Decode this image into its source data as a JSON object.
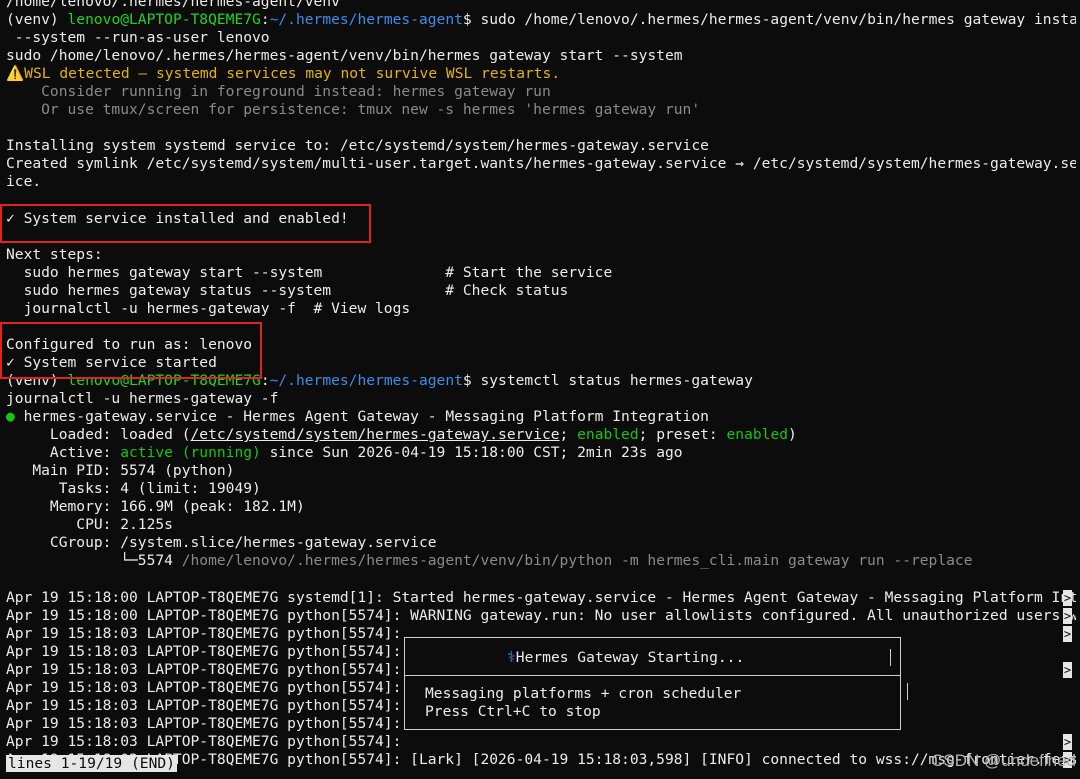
{
  "terminal": {
    "lines": {
      "l0": "/home/lenovo/.hermes/hermes-agent/venv",
      "l1_venv": "(venv) ",
      "l1_user": "lenovo@LAPTOP-T8QEME7G",
      "l1_colon": ":",
      "l1_path": "~/.hermes/hermes-agent",
      "l1_cmd": "$ sudo /home/lenovo/.hermes/hermes-agent/venv/bin/hermes gateway install",
      "l2": " --system --run-as-user lenovo",
      "l3": "sudo /home/lenovo/.hermes/hermes-agent/venv/bin/hermes gateway start --system",
      "l4_icon": "⚠️",
      "l4": "WSL detected — systemd services may not survive WSL restarts.",
      "l5": "    Consider running in foreground instead: hermes gateway run",
      "l6": "    Or use tmux/screen for persistence: tmux new -s hermes 'hermes gateway run'",
      "l8": "Installing system systemd service to: /etc/systemd/system/hermes-gateway.service",
      "l9": "Created symlink /etc/systemd/system/multi-user.target.wants/hermes-gateway.service → /etc/systemd/system/hermes-gateway.serv",
      "l10": "ice.",
      "l12": "✓ System service installed and enabled!",
      "l14": "Next steps:",
      "l15": "  sudo hermes gateway start --system              # Start the service",
      "l16": "  sudo hermes gateway status --system             # Check status",
      "l17": "  journalctl -u hermes-gateway -f  # View logs",
      "l19": "Configured to run as: lenovo",
      "l20": "✓ System service started",
      "l21_venv": "(venv) ",
      "l21_user": "lenovo@LAPTOP-T8QEME7G",
      "l21_colon": ":",
      "l21_path": "~/.hermes/hermes-agent",
      "l21_cmd": "$ systemctl status hermes-gateway",
      "l22": "journalctl -u hermes-gateway -f",
      "l23_dot": "●",
      "l23": " hermes-gateway.service - Hermes Agent Gateway - Messaging Platform Integration",
      "l24_a": "     Loaded: loaded (",
      "l24_link": "/etc/systemd/system/hermes-gateway.service",
      "l24_b": "; ",
      "l24_en1": "enabled",
      "l24_c": "; preset: ",
      "l24_en2": "enabled",
      "l24_d": ")",
      "l25_a": "     Active: ",
      "l25_active": "active (running)",
      "l25_b": " since Sun 2026-04-19 15:18:00 CST; 2min 23s ago",
      "l26": "   Main PID: 5574 (python)",
      "l27": "      Tasks: 4 (limit: 19049)",
      "l28": "     Memory: 166.9M (peak: 182.1M)",
      "l29": "        CPU: 2.125s",
      "l30": "     CGroup: /system.slice/hermes-gateway.service",
      "l31_tree": "             └─5574 ",
      "l31": "/home/lenovo/.hermes/hermes-agent/venv/bin/python -m hermes_cli.main gateway run --replace",
      "l33": "Apr 19 15:18:00 LAPTOP-T8QEME7G systemd[1]: Started hermes-gateway.service - Hermes Agent Gateway - Messaging Platform Inte",
      "l34": "Apr 19 15:18:00 LAPTOP-T8QEME7G python[5574]: WARNING gateway.run: No user allowlists configured. All unauthorized users wi",
      "l35": "Apr 19 15:18:03 LAPTOP-T8QEME7G python[5574]:",
      "l36": "Apr 19 15:18:03 LAPTOP-T8QEME7G python[5574]:",
      "l37": "Apr 19 15:18:03 LAPTOP-T8QEME7G python[5574]:",
      "l38": "Apr 19 15:18:03 LAPTOP-T8QEME7G python[5574]:",
      "l39": "Apr 19 15:18:03 LAPTOP-T8QEME7G python[5574]:",
      "l40": "Apr 19 15:18:03 LAPTOP-T8QEME7G python[5574]:",
      "l41": "Apr 19 15:18:03 LAPTOP-T8QEME7G python[5574]:",
      "l42": "Apr 19 15:18:03 LAPTOP-T8QEME7G python[5574]: [Lark] [2026-04-19 15:18:03,598] [INFO] connected to wss://msg-frontier.feish",
      "overflow_marker": ">"
    },
    "banner": {
      "star": "⚕",
      "title": "Hermes Gateway Starting...",
      "line1": "Messaging platforms + cron scheduler",
      "line2": "Press Ctrl+C to stop"
    },
    "pager_status": "lines 1-19/19 (END)"
  },
  "watermark": "CSDN @undefined",
  "colors": {
    "background": "#0c0c0c",
    "foreground": "#ececec",
    "prompt_user": "#1fd61f",
    "prompt_path": "#3b8eea",
    "warning": "#e5b20a",
    "active_green": "#16c60c",
    "highlight_box": "#e0231c"
  }
}
